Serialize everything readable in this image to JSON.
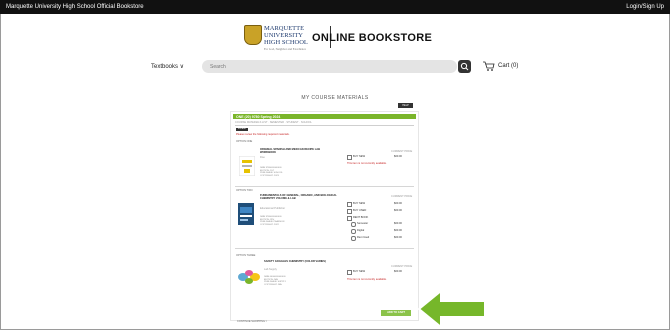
{
  "topbar": {
    "left": "Marquette University High School Official Bookstore",
    "right": "Login/Sign Up"
  },
  "logo": {
    "school_line1": "MARQUETTE",
    "school_line2": "UNIVERSITY",
    "school_line3": "HIGH SCHOOL",
    "tagline": "For God, Neighbor and Excellence"
  },
  "brand": "ONLINE BOOKSTORE",
  "nav": {
    "textbooks": "Textbooks ∨",
    "search_placeholder": "Search",
    "cart": "Cart (0)"
  },
  "page_heading": "MY COURSE MATERIALS",
  "panel": {
    "term": "ONE (20) 9780 Spring 2024",
    "line1": "COURSE MATERIALS LIST · SEMESTER · STUDENT · SCHOOL",
    "badge": "EXPAND",
    "alert": "Please review the following required materials.",
    "sections": [
      {
        "label": "OPTION ONE",
        "title": "ORIGINAL SPANISH AND MEXICAN RECIPE LAB WORKBOOK",
        "author": "Doe",
        "meta": "ISBN 9780000000000\nEDITION: 1ST\nPUBLISHER: SCHOOL\nCOPYRIGHT: 2023",
        "req": "CURRENT PRICE",
        "opts": [
          {
            "label": "BUY NEW",
            "price": "$00.00"
          }
        ],
        "red": "This item is not currently available."
      },
      {
        "label": "OPTION TWO",
        "title": "FUNDAMENTALS OF GENERAL, ORGANIC, AND BIOLOGICAL CHEMISTRY VOLUME & LAB",
        "author": "Educational Publisher",
        "meta": "ISBN 9780000000000\nEDITION: 9TH\nPUBLISHER: PEARSON\nCOPYRIGHT: 2022",
        "req": "CURRENT PRICE",
        "opts": [
          {
            "label": "BUY NEW",
            "price": "$00.00"
          },
          {
            "label": "BUY USED",
            "price": "$00.00"
          },
          {
            "label": "RENT BOOK",
            "price": ""
          },
          {
            "label": "Semester",
            "price": "$00.00"
          },
          {
            "label": "Digital",
            "price": "$00.00"
          },
          {
            "label": "Rent Used",
            "price": "$00.00"
          }
        ],
        "red": ""
      },
      {
        "label": "OPTION THREE",
        "title": "SAFETY GOGGLES CHEMISTRY (COLOR VARIES)",
        "author": "Lab Supply",
        "meta": "ISBN 0000000000000\nEDITION: N/A\nPUBLISHER: SUPPLY\nCOPYRIGHT: N/A",
        "req": "CURRENT PRICE",
        "opts": [
          {
            "label": "BUY NEW",
            "price": "$00.00"
          }
        ],
        "red": "This item is not currently available."
      }
    ],
    "add_button": "ADD TO CART",
    "footer": "CONTINUE SHOPPING >"
  },
  "colors": {
    "green": "#7ab52a",
    "arrow": "#76b72a",
    "dark": "#111111"
  }
}
